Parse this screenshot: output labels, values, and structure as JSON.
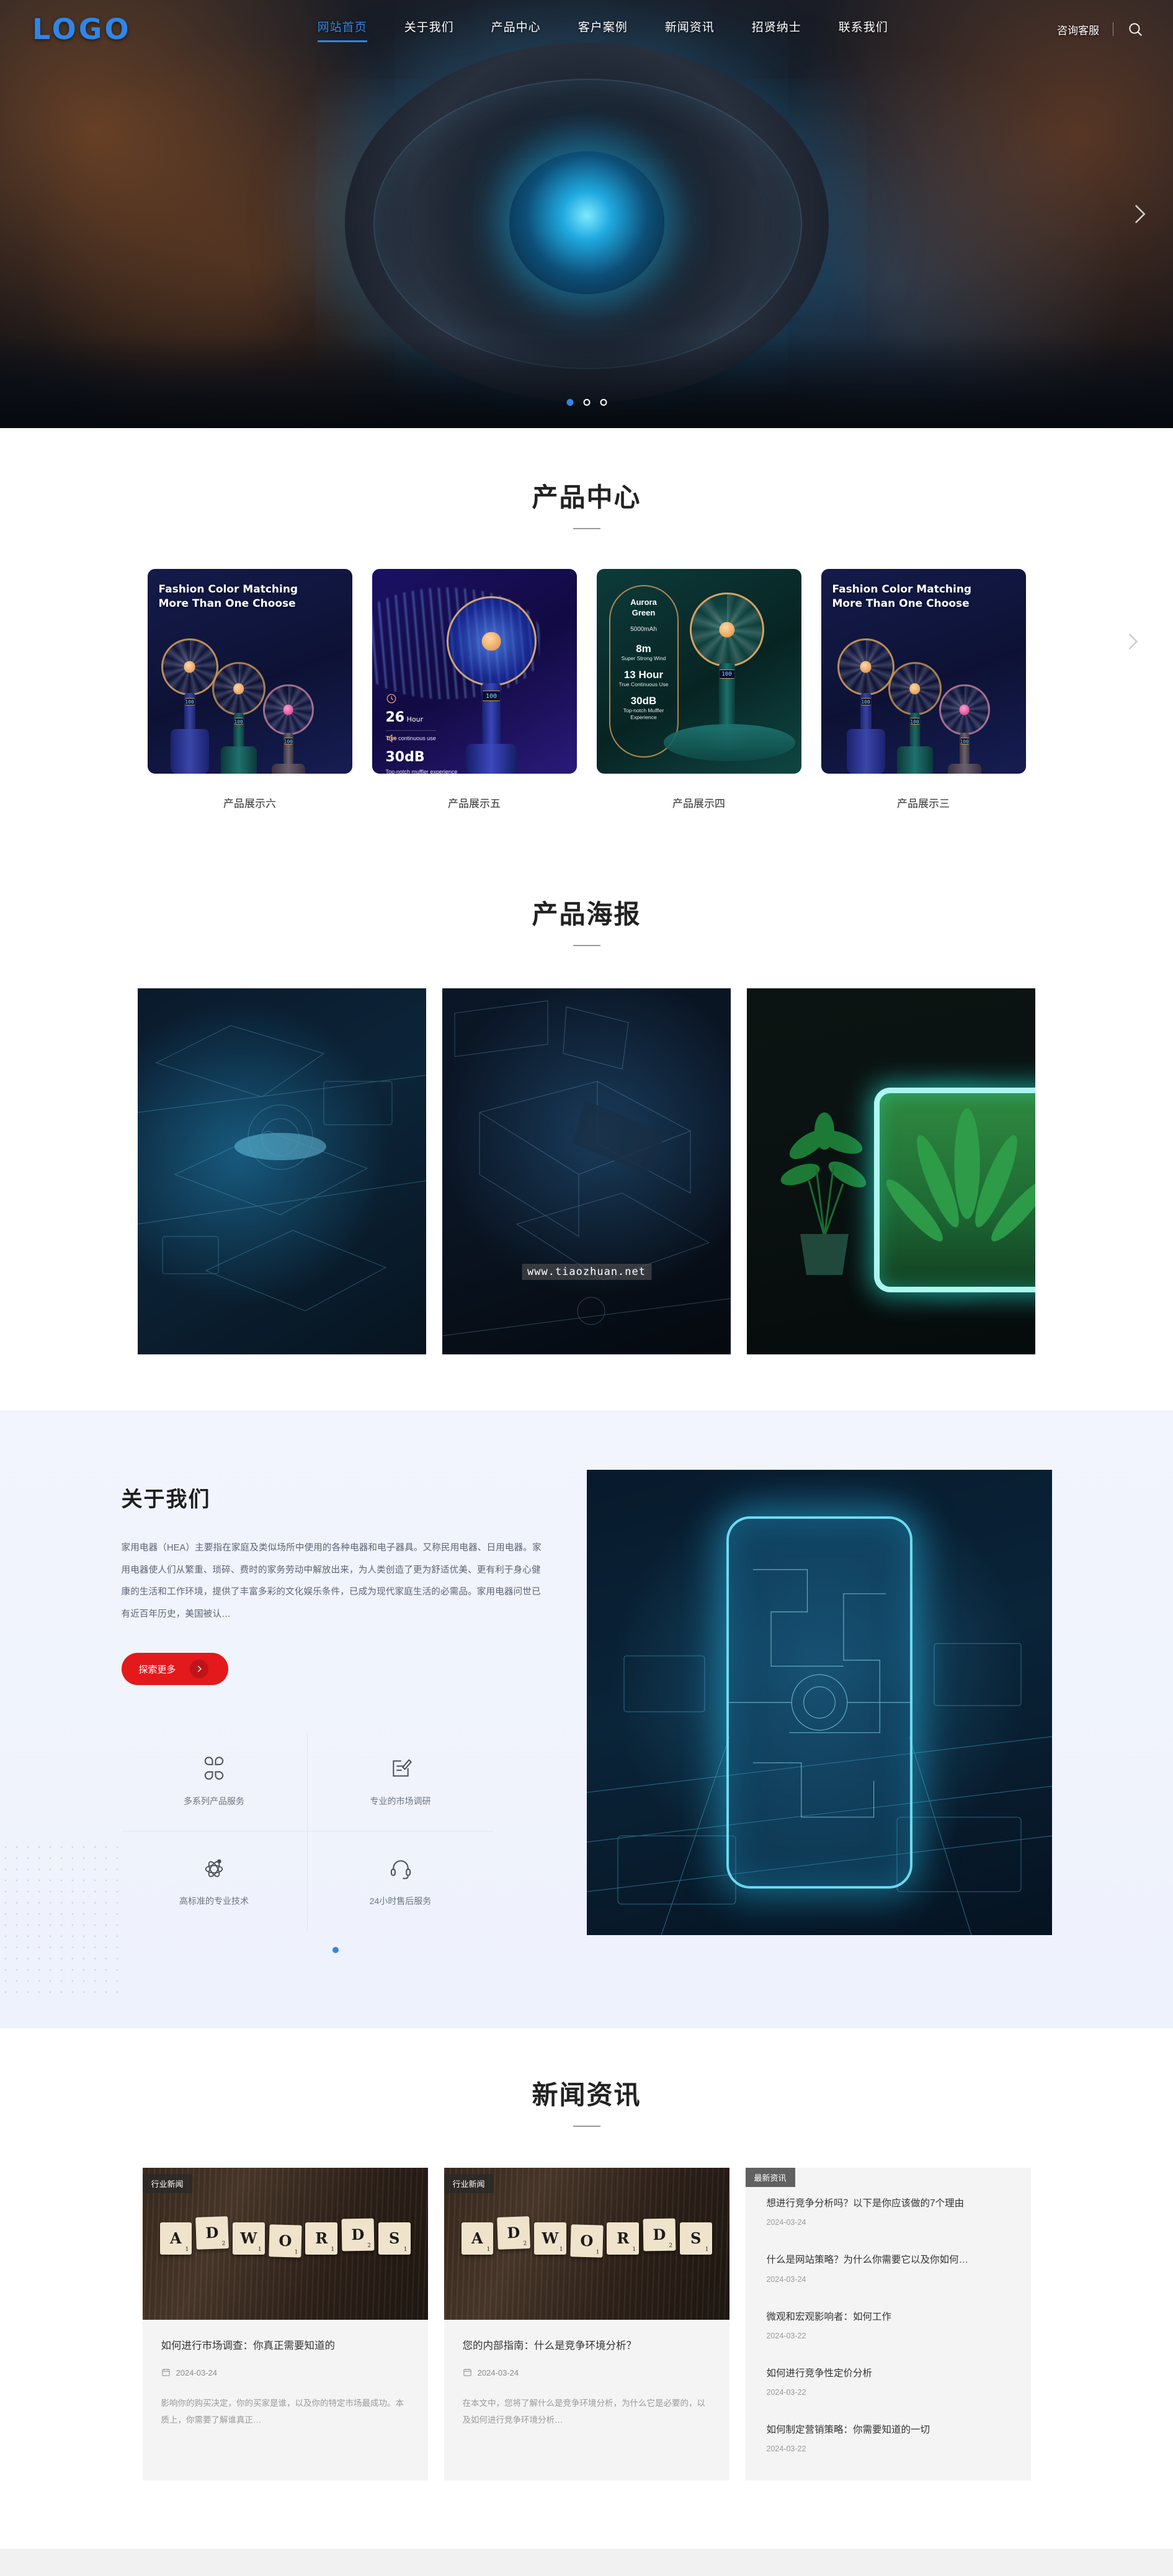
{
  "header": {
    "logo": "LOGO",
    "nav": [
      {
        "label": "网站首页",
        "active": true
      },
      {
        "label": "关于我们",
        "active": false
      },
      {
        "label": "产品中心",
        "active": false
      },
      {
        "label": "客户案例",
        "active": false
      },
      {
        "label": "新闻资讯",
        "active": false
      },
      {
        "label": "招贤纳士",
        "active": false
      },
      {
        "label": "联系我们",
        "active": false
      }
    ],
    "service_label": "咨询客服",
    "search_icon": "search-icon"
  },
  "hero": {
    "next_arrow_icon": "chevron-right-icon",
    "dots": [
      "active",
      "inactive",
      "inactive"
    ],
    "accent": "#2f86e8"
  },
  "products": {
    "title": "产品中心",
    "next_arrow_icon": "chevron-right-icon",
    "items": [
      {
        "caption": "产品展示六",
        "style": "navy",
        "poster_title": "Fashion Color Matching\nMore Than One Choose"
      },
      {
        "caption": "产品展示五",
        "style": "blue",
        "specs": [
          {
            "value": "26",
            "unit": "Hour",
            "note": "True continuous use"
          },
          {
            "value": "30dB",
            "unit": "",
            "note": "Top-notch muffler experience"
          }
        ]
      },
      {
        "caption": "产品展示四",
        "style": "green",
        "badge": {
          "name": "Aurora Green",
          "capacity": "5000mAh",
          "specs": [
            {
              "value": "8m",
              "note": "Super Strong Wind"
            },
            {
              "value": "13 Hour",
              "note": "True Continuous Use"
            },
            {
              "value": "30dB",
              "note": "Top-notch Muffler Experience"
            }
          ]
        }
      },
      {
        "caption": "产品展示三",
        "style": "navy",
        "poster_title": "Fashion Color Matching\nMore Than One Choose"
      }
    ]
  },
  "posters": {
    "title": "产品海报",
    "items": [
      {
        "name": "poster-holographic-workstation",
        "watermark": ""
      },
      {
        "name": "poster-dark-tech-device",
        "watermark": "www.tiaozhuan.net"
      },
      {
        "name": "poster-neon-plant-display",
        "watermark": ""
      }
    ]
  },
  "about": {
    "title": "关于我们",
    "paragraph": "家用电器（HEA）主要指在家庭及类似场所中使用的各种电器和电子器具。又称民用电器、日用电器。家用电器使人们从繁重、琐碎、费时的家务劳动中解放出来，为人类创造了更为舒适优美、更有利于身心健康的生活和工作环境，提供了丰富多彩的文化娱乐条件，已成为现代家庭生活的必需品。家用电器问世已有近百年历史，美国被认…",
    "button_label": "探索更多",
    "button_icon": "chevron-right-icon",
    "button_color": "#e4191c",
    "features": [
      {
        "icon": "grid-flower-icon",
        "label": "多系列产品服务"
      },
      {
        "icon": "edit-document-icon",
        "label": "专业的市场调研"
      },
      {
        "icon": "atom-icon",
        "label": "高标准的专业技术"
      },
      {
        "icon": "headset-icon",
        "label": "24小时售后服务"
      }
    ],
    "pager_dots": [
      "active"
    ]
  },
  "news": {
    "title": "新闻资讯",
    "cards": [
      {
        "tag": "行业新闻",
        "thumb_letters": [
          "A",
          "D",
          "W",
          "O",
          "R",
          "D",
          "S"
        ],
        "thumb_subs": [
          "1",
          "2",
          "1",
          "1",
          "1",
          "2",
          "1"
        ],
        "title": "如何进行市场调查：你真正需要知道的",
        "date": "2024-03-24",
        "date_icon": "calendar-icon",
        "desc": "影响你的购买决定，你的买家是谁，以及你的特定市场最成功。本质上，你需要了解谁真正…"
      },
      {
        "tag": "行业新闻",
        "thumb_letters": [
          "A",
          "D",
          "W",
          "O",
          "R",
          "D",
          "S"
        ],
        "thumb_subs": [
          "1",
          "2",
          "1",
          "1",
          "1",
          "2",
          "1"
        ],
        "title": "您的内部指南：什么是竞争环境分析？",
        "date": "2024-03-24",
        "date_icon": "calendar-icon",
        "desc": "在本文中，您将了解什么是竞争环境分析，为什么它是必要的，以及如何进行竞争环境分析…"
      }
    ],
    "list": {
      "tag": "最新资讯",
      "items": [
        {
          "title": "想进行竞争分析吗？以下是你应该做的7个理由",
          "date": "2024-03-24"
        },
        {
          "title": "什么是网站策略？为什么你需要它以及你如何…",
          "date": "2024-03-24"
        },
        {
          "title": "微观和宏观影响者：如何工作",
          "date": "2024-03-22"
        },
        {
          "title": "如何进行竞争性定价分析",
          "date": "2024-03-22"
        },
        {
          "title": "如何制定营销策略：你需要知道的一切",
          "date": "2024-03-22"
        }
      ]
    }
  }
}
